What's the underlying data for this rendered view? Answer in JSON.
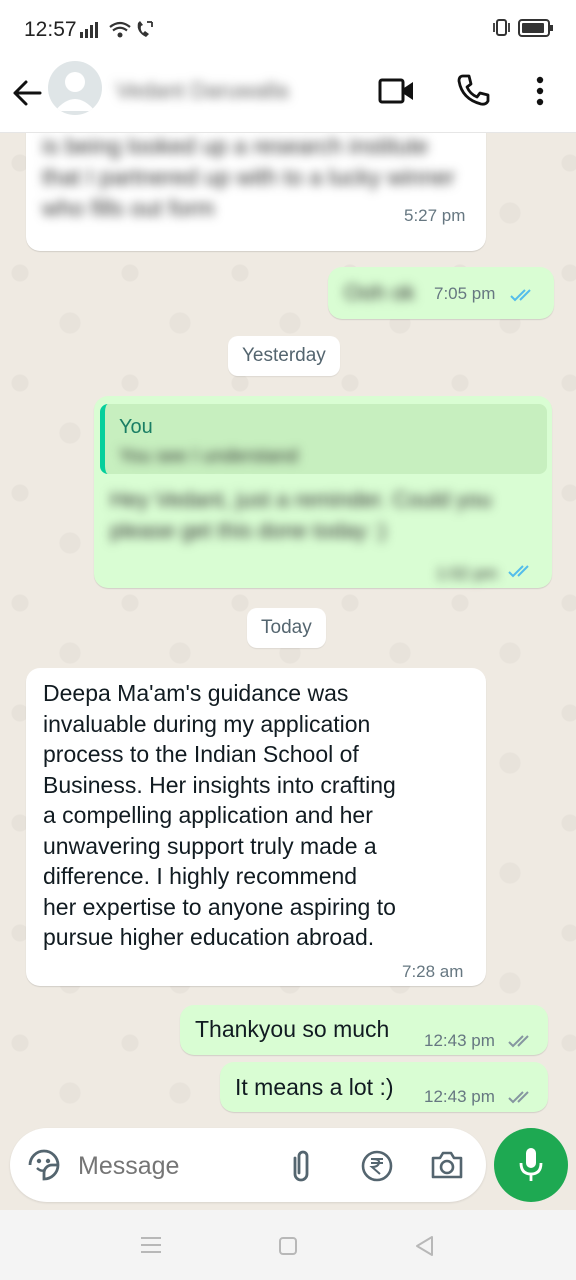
{
  "status_bar": {
    "time": "12:57"
  },
  "header": {
    "contact_name": "Vedant Daruwalla"
  },
  "messages": {
    "m1_blurred_text": "is being looked up a research institute that I partnered up with to a lucky winner who fills out form",
    "m1_time": "5:27 pm",
    "m2_blurred_text": "Ooh ok",
    "m2_time": "7:05 pm",
    "date_yesterday": "Yesterday",
    "m3_quote_author": "You",
    "m3_quote_text_blurred": "You see I understand",
    "m3_blurred_text": "Hey Vedant, just a reminder. Could you please get this done today :)",
    "m3_time": "1:02 pm",
    "date_today": "Today",
    "m4_lines": [
      "Deepa Ma'am's guidance was",
      "invaluable during my application",
      "process to the Indian School of",
      "Business. Her insights into crafting",
      "a compelling application and her",
      "unwavering support truly made a",
      "difference. I highly recommend",
      "her expertise to anyone aspiring to",
      "pursue higher education abroad."
    ],
    "m4_time": "7:28 am",
    "m5_text": "Thankyou so much",
    "m5_time": "12:43 pm",
    "m6_text": "It means a lot :)",
    "m6_time": "12:43 pm"
  },
  "composer": {
    "placeholder": "Message"
  },
  "colors": {
    "incoming_bubble": "#ffffff",
    "outgoing_bubble": "#d9fdd3",
    "accent_green": "#1ea952",
    "read_tick_blue": "#53bdeb",
    "delivered_tick_gray": "#8696a0",
    "chat_background": "#efeae2"
  },
  "icons": {
    "back": "arrow-left-icon",
    "video": "video-call-icon",
    "phone": "phone-icon",
    "menu": "more-vert-icon",
    "emoji": "sticker-icon",
    "attach": "paperclip-icon",
    "payment": "rupee-icon",
    "camera": "camera-icon",
    "mic": "mic-icon"
  }
}
